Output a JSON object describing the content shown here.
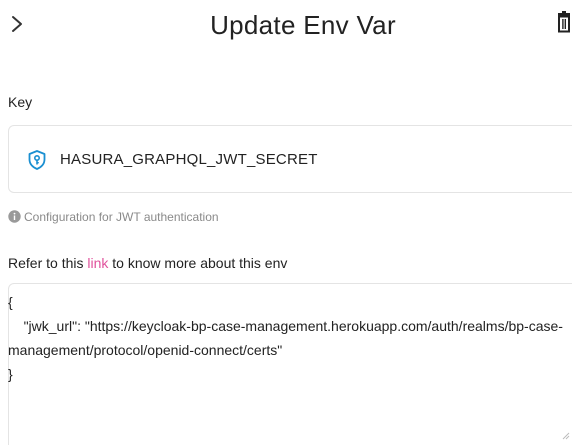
{
  "header": {
    "title": "Update Env Var",
    "back_icon": "chevron-right-icon",
    "delete_icon": "trash-icon"
  },
  "key_section": {
    "label": "Key",
    "value": "HASURA_GRAPHQL_JWT_SECRET",
    "icon": "shield-key-icon",
    "icon_color": "#1a8fd1"
  },
  "info": {
    "icon": "info-icon",
    "text": "Configuration for JWT authentication"
  },
  "refer": {
    "prefix": "Refer to this ",
    "link_text": "link",
    "suffix": " to know more about this env",
    "link_color": "#e0529c"
  },
  "value_section": {
    "text": "{\n    \"jwk_url\": \"https://keycloak-bp-case-management.herokuapp.com/auth/realms/bp-case-management/protocol/openid-connect/certs\"\n}"
  }
}
